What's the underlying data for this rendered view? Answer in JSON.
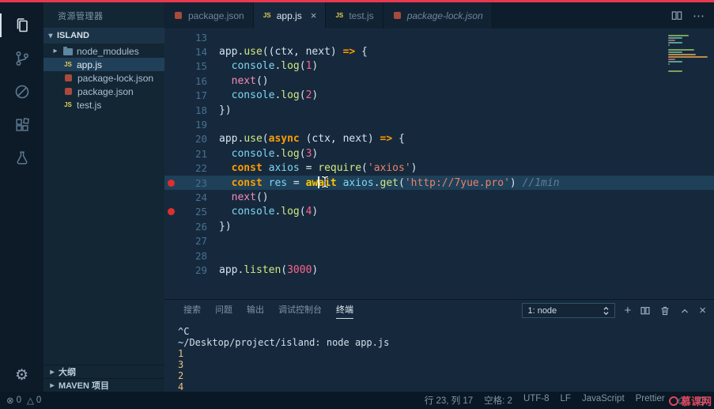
{
  "icons": {
    "error": "⊗",
    "warning": "△",
    "gear": "⚙",
    "more": "⋯",
    "smiley": "☺",
    "chev_down": "▾",
    "chev_right": "▸",
    "close": "×",
    "plus": "+"
  },
  "colors": {
    "top_bar": "#e8384f",
    "watermark": "#ee4e63",
    "breakpoint": "#e02e2e",
    "line_highlight": "#1e4058",
    "editor_bg": "#16293c"
  },
  "activity_bar": {
    "items": [
      {
        "name": "explorer",
        "active": true
      },
      {
        "name": "source-control",
        "active": false
      },
      {
        "name": "circle-slash",
        "active": false
      },
      {
        "name": "extensions",
        "active": false
      },
      {
        "name": "tests",
        "active": false
      }
    ]
  },
  "sidebar": {
    "title": "资源管理器",
    "section": "ISLAND",
    "files": [
      {
        "label": "node_modules",
        "icon": "folder",
        "chevron": true
      },
      {
        "label": "app.js",
        "icon": "js",
        "selected": true
      },
      {
        "label": "package-lock.json",
        "icon": "npm"
      },
      {
        "label": "package.json",
        "icon": "npm"
      },
      {
        "label": "test.js",
        "icon": "js"
      }
    ],
    "bottom_sections": [
      "大纲",
      "MAVEN 项目"
    ]
  },
  "editor_tabs": [
    {
      "label": "package.json",
      "icon": "npm"
    },
    {
      "label": "app.js",
      "icon": "js",
      "active": true
    },
    {
      "label": "test.js",
      "icon": "js"
    },
    {
      "label": "package-lock.json",
      "icon": "npm",
      "preview": true
    }
  ],
  "editor": {
    "first_line": 13,
    "cursor": {
      "line": 23,
      "col": 17
    },
    "lines": [
      {
        "num": 13,
        "tokens": []
      },
      {
        "num": 14,
        "tokens": [
          [
            "app",
            "pl"
          ],
          [
            ".",
            "pl"
          ],
          [
            "use",
            "fn"
          ],
          [
            "((",
            "pl"
          ],
          [
            "ctx",
            "pl"
          ],
          [
            ", ",
            "pl"
          ],
          [
            "next",
            "pl"
          ],
          [
            ") ",
            "pl"
          ],
          [
            "=>",
            "kw"
          ],
          [
            " {",
            "pl"
          ]
        ]
      },
      {
        "num": 15,
        "tokens": [
          [
            "  ",
            "pl"
          ],
          [
            "console",
            "vr"
          ],
          [
            ".",
            "pl"
          ],
          [
            "log",
            "fn"
          ],
          [
            "(",
            "pl"
          ],
          [
            "1",
            "nm"
          ],
          [
            ")",
            "pl"
          ]
        ]
      },
      {
        "num": 16,
        "tokens": [
          [
            "  ",
            "pl"
          ],
          [
            "next",
            "nx"
          ],
          [
            "()",
            "pl"
          ]
        ]
      },
      {
        "num": 17,
        "tokens": [
          [
            "  ",
            "pl"
          ],
          [
            "console",
            "vr"
          ],
          [
            ".",
            "pl"
          ],
          [
            "log",
            "fn"
          ],
          [
            "(",
            "pl"
          ],
          [
            "2",
            "nm"
          ],
          [
            ")",
            "pl"
          ]
        ]
      },
      {
        "num": 18,
        "tokens": [
          [
            "})",
            "pl"
          ]
        ]
      },
      {
        "num": 19,
        "tokens": []
      },
      {
        "num": 20,
        "tokens": [
          [
            "app",
            "pl"
          ],
          [
            ".",
            "pl"
          ],
          [
            "use",
            "fn"
          ],
          [
            "(",
            "pl"
          ],
          [
            "async",
            "kw"
          ],
          [
            " (",
            "pl"
          ],
          [
            "ctx",
            "pl"
          ],
          [
            ", ",
            "pl"
          ],
          [
            "next",
            "pl"
          ],
          [
            ") ",
            "pl"
          ],
          [
            "=>",
            "kw"
          ],
          [
            " {",
            "pl"
          ]
        ]
      },
      {
        "num": 21,
        "tokens": [
          [
            "  ",
            "pl"
          ],
          [
            "console",
            "vr"
          ],
          [
            ".",
            "pl"
          ],
          [
            "log",
            "fn"
          ],
          [
            "(",
            "pl"
          ],
          [
            "3",
            "nm"
          ],
          [
            ")",
            "pl"
          ]
        ]
      },
      {
        "num": 22,
        "tokens": [
          [
            "  ",
            "pl"
          ],
          [
            "const",
            "kw"
          ],
          [
            " ",
            "pl"
          ],
          [
            "axios",
            "vr"
          ],
          [
            " = ",
            "pl"
          ],
          [
            "require",
            "fn"
          ],
          [
            "(",
            "pl"
          ],
          [
            "'axios'",
            "st"
          ],
          [
            ")",
            "pl"
          ]
        ]
      },
      {
        "num": 23,
        "breakpoint": true,
        "highlight": true,
        "tokens": [
          [
            "  ",
            "pl"
          ],
          [
            "const",
            "kw"
          ],
          [
            " ",
            "pl"
          ],
          [
            "res",
            "vr"
          ],
          [
            " = ",
            "pl"
          ],
          [
            "await",
            "aw"
          ],
          [
            " ",
            "pl"
          ],
          [
            "axios",
            "vr"
          ],
          [
            ".",
            "pl"
          ],
          [
            "get",
            "fn"
          ],
          [
            "(",
            "pl"
          ],
          [
            "'http://7yue.pro'",
            "st"
          ],
          [
            ")",
            "pl"
          ],
          [
            " ",
            "pl"
          ],
          [
            "//1min",
            "cm"
          ]
        ]
      },
      {
        "num": 24,
        "tokens": [
          [
            "  ",
            "pl"
          ],
          [
            "next",
            "nx"
          ],
          [
            "()",
            "pl"
          ]
        ]
      },
      {
        "num": 25,
        "breakpoint": true,
        "tokens": [
          [
            "  ",
            "pl"
          ],
          [
            "console",
            "vr"
          ],
          [
            ".",
            "pl"
          ],
          [
            "log",
            "fn"
          ],
          [
            "(",
            "pl"
          ],
          [
            "4",
            "nm"
          ],
          [
            ")",
            "pl"
          ]
        ]
      },
      {
        "num": 26,
        "tokens": [
          [
            "})",
            "pl"
          ]
        ]
      },
      {
        "num": 27,
        "tokens": []
      },
      {
        "num": 28,
        "tokens": []
      },
      {
        "num": 29,
        "tokens": [
          [
            "app",
            "pl"
          ],
          [
            ".",
            "pl"
          ],
          [
            "listen",
            "fn"
          ],
          [
            "(",
            "pl"
          ],
          [
            "3000",
            "nm"
          ],
          [
            ")",
            "pl"
          ]
        ]
      }
    ]
  },
  "panel": {
    "tabs": [
      {
        "label": "搜索"
      },
      {
        "label": "问题"
      },
      {
        "label": "输出"
      },
      {
        "label": "调试控制台"
      },
      {
        "label": "终端",
        "active": true
      }
    ],
    "terminal_select": "1: node",
    "terminal_lines": [
      {
        "text": "^C",
        "c": "pl"
      },
      {
        "text": "~/Desktop/project/island: node app.js",
        "c": "pl"
      },
      {
        "text": "1",
        "c": "y"
      },
      {
        "text": "3",
        "c": "y"
      },
      {
        "text": "2",
        "c": "y"
      },
      {
        "text": "4",
        "c": "y"
      }
    ]
  },
  "status_bar": {
    "errors": "0",
    "warnings": "0",
    "right_items": [
      "行 23, 列 17",
      "空格: 2",
      "UTF-8",
      "LF",
      "JavaScript",
      "Prettier"
    ]
  },
  "watermark": "慕课网"
}
